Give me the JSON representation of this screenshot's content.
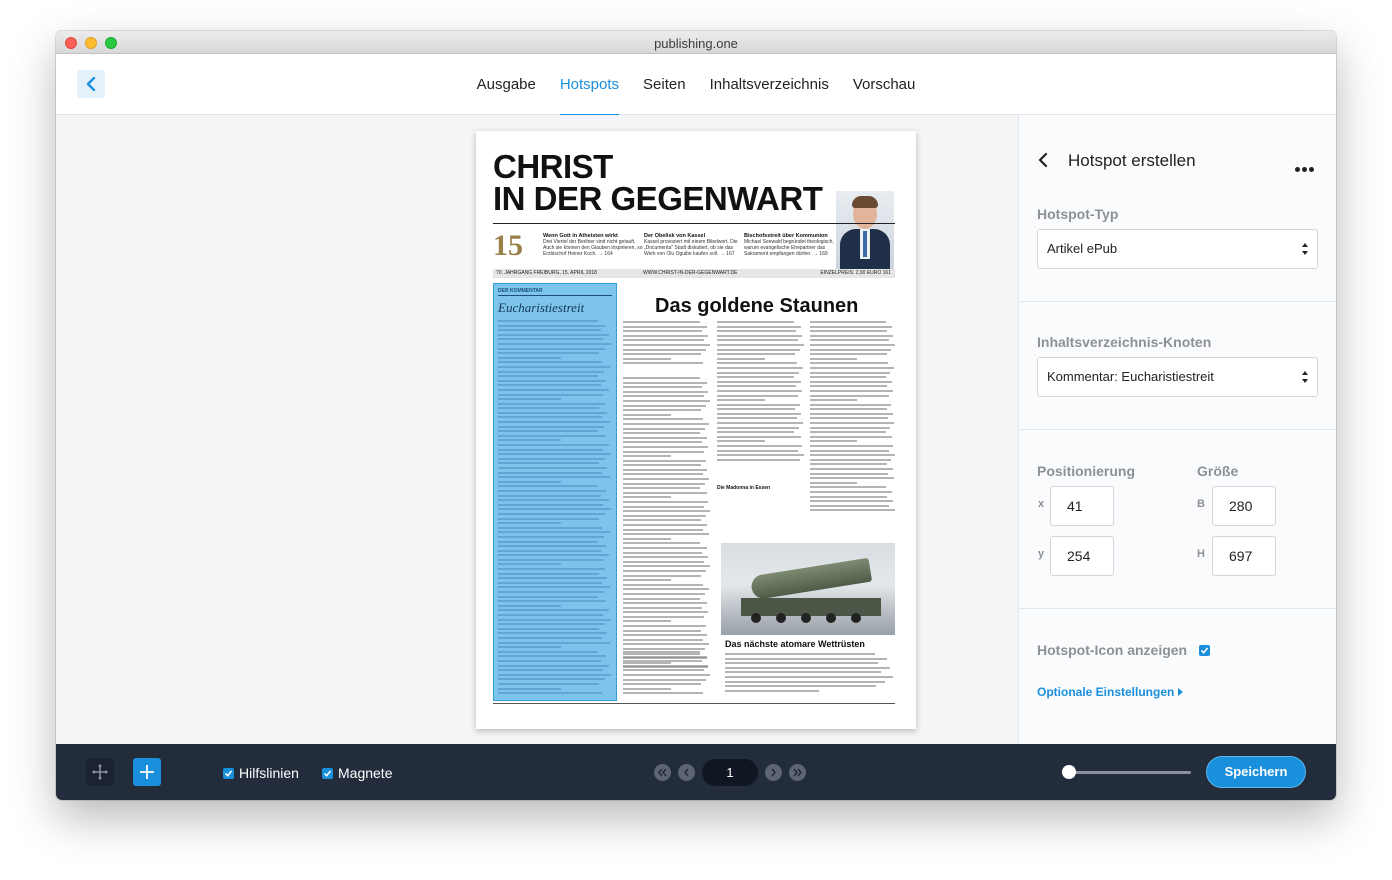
{
  "window": {
    "title": "publishing.one"
  },
  "nav": {
    "back_icon": "chevron-left-icon",
    "tabs": [
      {
        "label": "Ausgabe",
        "active": false
      },
      {
        "label": "Hotspots",
        "active": true
      },
      {
        "label": "Seiten",
        "active": false
      },
      {
        "label": "Inhaltsverzeichnis",
        "active": false
      },
      {
        "label": "Vorschau",
        "active": false
      }
    ]
  },
  "page": {
    "masthead_line1": "CHRIST",
    "masthead_line2": "IN DER GEGENWART",
    "issue_number": "15",
    "teasers": [
      {
        "title": "Wenn Gott in Atheisten wirkt",
        "text": "Drei Viertel der Berliner sind nicht getauft. Auch sie können den Glauben inspirieren, so Erzbischof Heiner Koch.",
        "ref": "→ 164"
      },
      {
        "title": "Der Obelisk von Kassel",
        "text": "Kassel provoziert mit einem Bibelwort. Die „Documenta\" Stadt diskutiert, ob sie das Werk von Olu Oguibe kaufen soll.",
        "ref": "→ 167"
      },
      {
        "title": "Bischofsstreit über Kommunion",
        "text": "Michael Seewald begründet theologisch, warum evangelische Ehepartner das Sakrament empfangen dürfen.",
        "ref": "→ 169"
      }
    ],
    "dateline": "70. JAHRGANG  FREIBURG, 15. APRIL 2018",
    "website": "WWW.CHRIST-IN-DER-GEGENWART.DE",
    "price": "EINZELPREIS: 2,90 EURO  161",
    "headline": "Das goldene Staunen",
    "subheading": "Die Madonna in Essen",
    "kommentar_label": "DER KOMMENTAR",
    "kommentar_title": "Eucharistiestreit",
    "photo_caption": "Das nächste atomare Wettrüsten"
  },
  "panel": {
    "title": "Hotspot erstellen",
    "hotspot_type_label": "Hotspot-Typ",
    "hotspot_type_value": "Artikel ePub",
    "toc_node_label": "Inhaltsverzeichnis-Knoten",
    "toc_node_value": "Kommentar: Eucharistiestreit",
    "position_label": "Positionierung",
    "size_label": "Größe",
    "x_label": "x",
    "y_label": "y",
    "b_label": "B",
    "h_label": "H",
    "x_value": "41",
    "y_value": "254",
    "b_value": "280",
    "h_value": "697",
    "show_icon_label": "Hotspot-Icon anzeigen",
    "show_icon_checked": true,
    "optional_label": "Optionale Einstellungen"
  },
  "bottom": {
    "guides_label": "Hilfslinien",
    "guides_checked": true,
    "magnets_label": "Magnete",
    "magnets_checked": true,
    "page_number": "1",
    "zoom_level": 0,
    "save_label": "Speichern"
  },
  "colors": {
    "accent": "#1a8fdc",
    "bar": "#232c3b",
    "hotspot": "#7cc4eb"
  }
}
